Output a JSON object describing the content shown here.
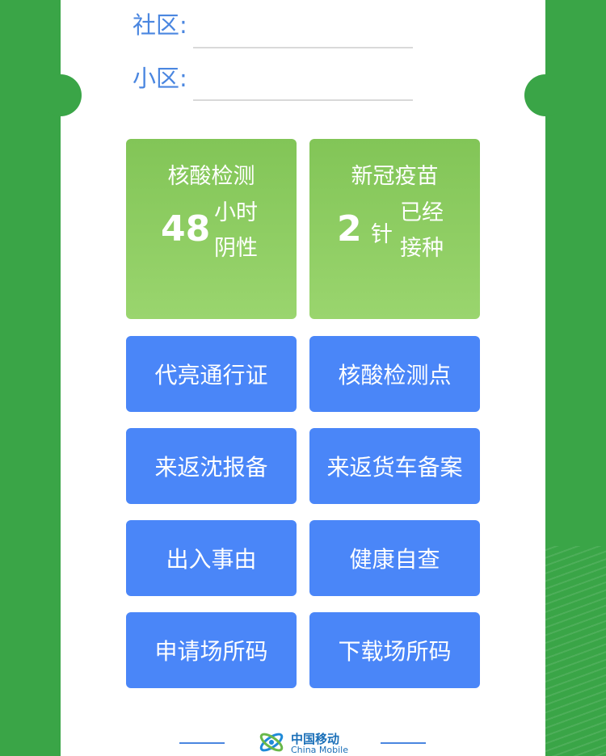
{
  "form": {
    "community_label": "社区:",
    "community_value": "",
    "neighborhood_label": "小区:",
    "neighborhood_value": ""
  },
  "status": {
    "nucleic": {
      "title": "核酸检测",
      "number": "48",
      "unit_line1": "小时",
      "unit_line2": "阴性"
    },
    "vaccine": {
      "title": "新冠疫苗",
      "number": "2",
      "unit_mid": "针",
      "unit_line1": "已经",
      "unit_line2": "接种"
    }
  },
  "actions": [
    "代亮通行证",
    "核酸检测点",
    "来返沈报备",
    "来返货车备案",
    "出入事由",
    "健康自查",
    "申请场所码",
    "下载场所码"
  ],
  "footer": {
    "logo_cn": "中国移动",
    "logo_en": "China Mobile"
  },
  "colors": {
    "background_green": "#3aa547",
    "tile_green": "#8fce63",
    "action_blue": "#4a86f8",
    "label_blue": "#4a86e0"
  },
  "icons": {
    "logo": "china-mobile-logo-icon"
  }
}
